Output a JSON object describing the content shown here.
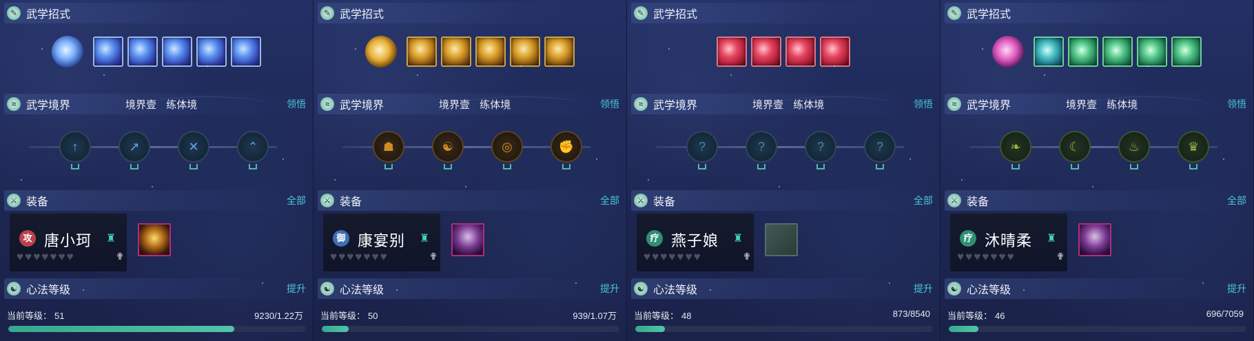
{
  "sections": {
    "skills_title": "武学招式",
    "realm_title": "武学境界",
    "realm_level": "境界壹",
    "realm_stage": "练体境",
    "realm_action": "领悟",
    "equip_title": "装备",
    "equip_action": "全部",
    "mind_title": "心法等级",
    "mind_action": "提升",
    "level_label": "当前等级：",
    "heart_symbol": "♥",
    "role_symbol": "♜",
    "pin_symbol": "✟"
  },
  "characters": [
    {
      "theme": "blue",
      "name": "唐小珂",
      "type_char": "攻",
      "type_color": "#b8424a",
      "skill_count": 5,
      "equip_style": "gold",
      "level": "51",
      "xp": "9230/1.22万",
      "progress": 0.76,
      "realm_icons": [
        "↑",
        "↗",
        "✕",
        "⌃"
      ]
    },
    {
      "theme": "gold",
      "name": "康宴别",
      "type_char": "御",
      "type_color": "#3f6fb3",
      "skill_count": 5,
      "equip_style": "purple",
      "level": "50",
      "xp": "939/1.07万",
      "progress": 0.09,
      "realm_icons": [
        "☗",
        "☯",
        "◎",
        "✊"
      ]
    },
    {
      "theme": "red",
      "name": "燕子娘",
      "type_char": "疗",
      "type_color": "#2f8f72",
      "skill_count": 4,
      "equip_style": "empty",
      "level": "48",
      "xp": "873/8540",
      "progress": 0.1,
      "realm_icons": [
        "?",
        "?",
        "?",
        "?"
      ]
    },
    {
      "theme": "green",
      "name": "沐晴柔",
      "type_char": "疗",
      "type_color": "#2f8f72",
      "skill_count": 5,
      "equip_style": "purple",
      "level": "46",
      "xp": "696/7059",
      "progress": 0.1,
      "realm_icons": [
        "❧",
        "☾",
        "♨",
        "♛"
      ]
    }
  ]
}
